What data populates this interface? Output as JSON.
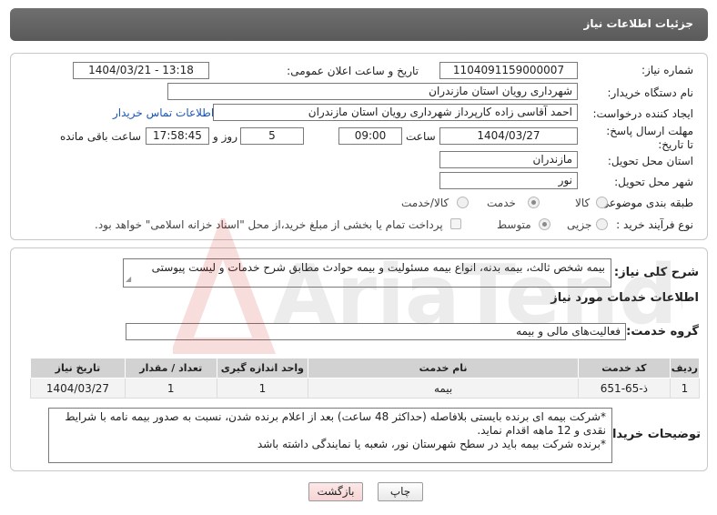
{
  "header": {
    "title": "جزئیات اطلاعات نیاز"
  },
  "form": {
    "need_number_label": "شماره نیاز:",
    "need_number": "1104091159000007",
    "announce_label": "تاریخ و ساعت اعلان عمومی:",
    "announce_value": "1404/03/21 - 13:18",
    "buyer_org_label": "نام دستگاه خریدار:",
    "buyer_org": "شهرداری رویان استان مازندران",
    "creator_label": "ایجاد کننده درخواست:",
    "creator": "احمد آقاسی زاده کارپرداز شهرداری رویان استان مازندران",
    "contact_link": "اطلاعات تماس خریدار",
    "deadline_label": "مهلت ارسال پاسخ: تا تاریخ:",
    "deadline_date": "1404/03/27",
    "time_label": "ساعت",
    "deadline_time": "09:00",
    "days_value": "5",
    "days_label": "روز و",
    "remaining_time": "17:58:45",
    "remaining_label": "ساعت باقی مانده",
    "province_label": "استان محل تحویل:",
    "province": "مازندران",
    "city_label": "شهر محل تحویل:",
    "city": "نور",
    "category_label": "طبقه بندی موضوعی:",
    "category_options": [
      "کالا",
      "خدمت",
      "کالا/خدمت"
    ],
    "category_selected": "خدمت",
    "process_label": "نوع فرآیند خرید :",
    "process_options": [
      "جزیی",
      "متوسط"
    ],
    "process_selected": "متوسط",
    "payment_note": "پرداخت تمام یا بخشی از مبلغ خرید،از محل \"اسناد خزانه اسلامی\" خواهد بود."
  },
  "summary": {
    "label": "شرح کلی نیاز:",
    "text": "بیمه شخص ثالث، بیمه بدنه، انواع بیمه مسئولیت و بیمه حوادث مطابق شرح خدمات و لیست پیوستی"
  },
  "services": {
    "section_title": "اطلاعات خدمات مورد نیاز",
    "group_label": "گروه خدمت:",
    "group_value": "فعالیت‌های مالی و بیمه",
    "columns": [
      "ردیف",
      "کد خدمت",
      "نام خدمت",
      "واحد اندازه گیری",
      "تعداد / مقدار",
      "تاریخ نیاز"
    ],
    "rows": [
      [
        "1",
        "ذ-65-651",
        "بیمه",
        "1",
        "1",
        "1404/03/27"
      ]
    ]
  },
  "buyer_notes": {
    "label": "توضیحات خریدار:",
    "lines": [
      "*شرکت بیمه ای برنده بایستی بلافاصله (حداکثر 48 ساعت) بعد از اعلام برنده شدن، نسبت به صدور بیمه نامه با شرایط",
      "نقدی و 12 ماهه اقدام نماید.",
      "*برنده شرکت بیمه باید در سطح شهرستان نور، شعبه یا نمایندگی داشته باشد"
    ]
  },
  "buttons": {
    "print": "چاپ",
    "back": "بازگشت"
  },
  "watermark": {
    "text": "AriaTender.neT"
  }
}
